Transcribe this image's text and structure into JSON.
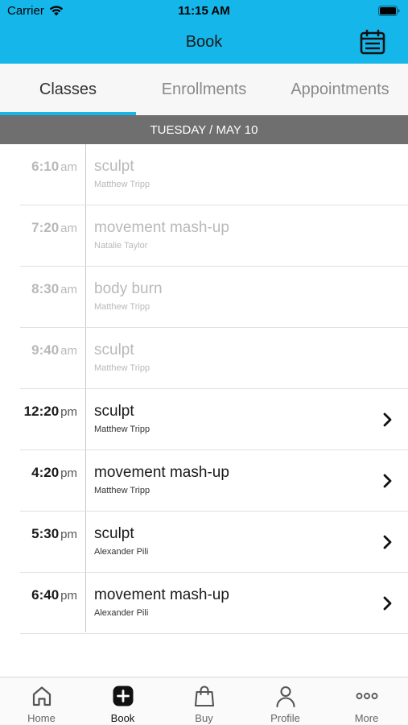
{
  "status": {
    "carrier": "Carrier",
    "time": "11:15 AM"
  },
  "header": {
    "title": "Book",
    "calendar_icon": "calendar-icon",
    "color": "#15b6ea"
  },
  "tabs": [
    {
      "label": "Classes",
      "active": true
    },
    {
      "label": "Enrollments",
      "active": false
    },
    {
      "label": "Appointments",
      "active": false
    }
  ],
  "date_bar": {
    "label": "TUESDAY / MAY 10"
  },
  "classes": [
    {
      "time": "6:10",
      "ampm": "am",
      "name": "sculpt",
      "instructor": "Matthew Tripp",
      "past": true
    },
    {
      "time": "7:20",
      "ampm": "am",
      "name": "movement mash-up",
      "instructor": "Natalie Taylor",
      "past": true
    },
    {
      "time": "8:30",
      "ampm": "am",
      "name": "body burn",
      "instructor": "Matthew Tripp",
      "past": true
    },
    {
      "time": "9:40",
      "ampm": "am",
      "name": "sculpt",
      "instructor": "Matthew Tripp",
      "past": true
    },
    {
      "time": "12:20",
      "ampm": "pm",
      "name": "sculpt",
      "instructor": "Matthew Tripp",
      "past": false
    },
    {
      "time": "4:20",
      "ampm": "pm",
      "name": "movement mash-up",
      "instructor": "Matthew Tripp",
      "past": false
    },
    {
      "time": "5:30",
      "ampm": "pm",
      "name": "sculpt",
      "instructor": "Alexander Pili",
      "past": false
    },
    {
      "time": "6:40",
      "ampm": "pm",
      "name": "movement mash-up",
      "instructor": "Alexander Pili",
      "past": false
    }
  ],
  "tabbar": [
    {
      "label": "Home",
      "icon": "home-icon",
      "active": false
    },
    {
      "label": "Book",
      "icon": "plus-square-icon",
      "active": true
    },
    {
      "label": "Buy",
      "icon": "shopping-bag-icon",
      "active": false
    },
    {
      "label": "Profile",
      "icon": "person-icon",
      "active": false
    },
    {
      "label": "More",
      "icon": "more-dots-icon",
      "active": false
    }
  ]
}
